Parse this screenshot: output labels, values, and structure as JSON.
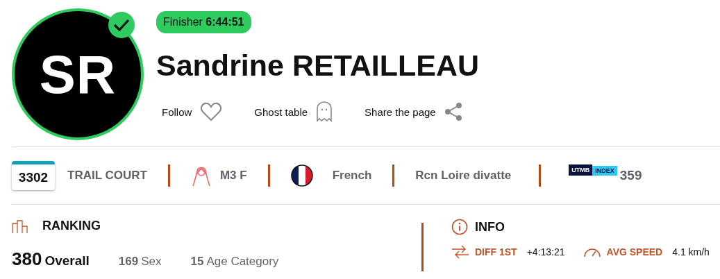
{
  "profile": {
    "initials": "SR",
    "finished": true,
    "status": {
      "label": "Finisher",
      "time": "6:44:51"
    },
    "name": "Sandrine RETAILLEAU",
    "actions": [
      {
        "kind": "follow",
        "label": "Follow"
      },
      {
        "kind": "ghost",
        "label": "Ghost table"
      },
      {
        "kind": "share",
        "label": "Share the page"
      }
    ]
  },
  "details": {
    "bib": "3302",
    "race": "TRAIL COURT",
    "category": "M3 F",
    "nationality": "French",
    "club": "Rcn Loire divatte",
    "index_logo": {
      "brand": "UTMB",
      "word": "INDEX"
    },
    "index": "359"
  },
  "ranking": {
    "title": "RANKING",
    "items": [
      {
        "kind": "main",
        "value": "380",
        "label": "Overall"
      },
      {
        "kind": "minor",
        "value": "169",
        "label": "Sex"
      },
      {
        "kind": "minor",
        "value": "15",
        "label": "Age Category"
      }
    ]
  },
  "info": {
    "title": "INFO",
    "items": [
      {
        "kind": "diff",
        "label": "DIFF 1ST",
        "value": "+4:13:21"
      },
      {
        "kind": "speed",
        "label": "AVG SPEED",
        "value": "4.1 km/h"
      }
    ]
  }
}
